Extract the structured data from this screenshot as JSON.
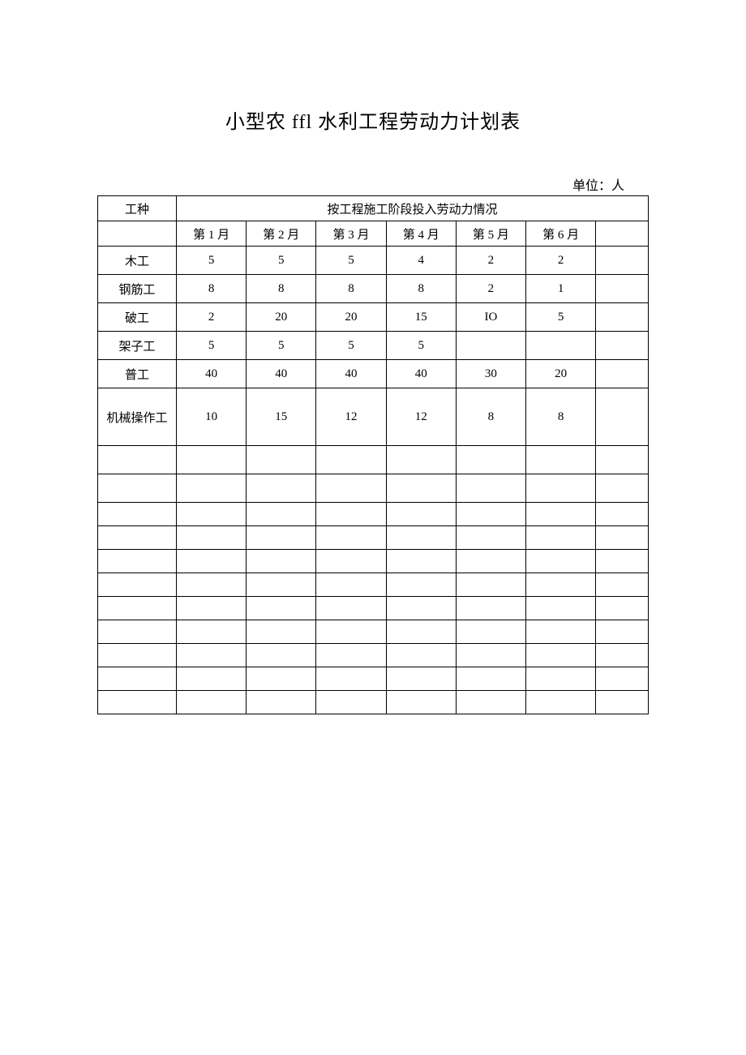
{
  "title": "小型农 ffl 水利工程劳动力计划表",
  "unit_label": "单位：人",
  "header": {
    "col_type": "工种",
    "span_label": "按工程施工阶段投入劳动力情况",
    "months": [
      "第 1 月",
      "第 2 月",
      "第 3 月",
      "第 4 月",
      "第 5 月",
      "第 6 月"
    ]
  },
  "rows": [
    {
      "label": "木工",
      "m": [
        "5",
        "5",
        "5",
        "4",
        "2",
        "2"
      ]
    },
    {
      "label": "钢筋工",
      "m": [
        "8",
        "8",
        "8",
        "8",
        "2",
        "1"
      ]
    },
    {
      "label": "破工",
      "m": [
        "2",
        "20",
        "20",
        "15",
        "IO",
        "5"
      ]
    },
    {
      "label": "架子工",
      "m": [
        "5",
        "5",
        "5",
        "5",
        "",
        ""
      ]
    },
    {
      "label": "普工",
      "m": [
        "40",
        "40",
        "40",
        "40",
        "30",
        "20"
      ]
    },
    {
      "label": "机械操作工",
      "m": [
        "10",
        "15",
        "12",
        "12",
        "8",
        "8"
      ]
    }
  ],
  "empty_rows": 11,
  "chart_data": {
    "type": "table",
    "title": "小型农 ffl 水利工程劳动力计划表",
    "unit": "人",
    "columns": [
      "工种",
      "第1月",
      "第2月",
      "第3月",
      "第4月",
      "第5月",
      "第6月"
    ],
    "data": [
      [
        "木工",
        5,
        5,
        5,
        4,
        2,
        2
      ],
      [
        "钢筋工",
        8,
        8,
        8,
        8,
        2,
        1
      ],
      [
        "破工",
        2,
        20,
        20,
        15,
        10,
        5
      ],
      [
        "架子工",
        5,
        5,
        5,
        5,
        null,
        null
      ],
      [
        "普工",
        40,
        40,
        40,
        40,
        30,
        20
      ],
      [
        "机械操作工",
        10,
        15,
        12,
        12,
        8,
        8
      ]
    ]
  }
}
